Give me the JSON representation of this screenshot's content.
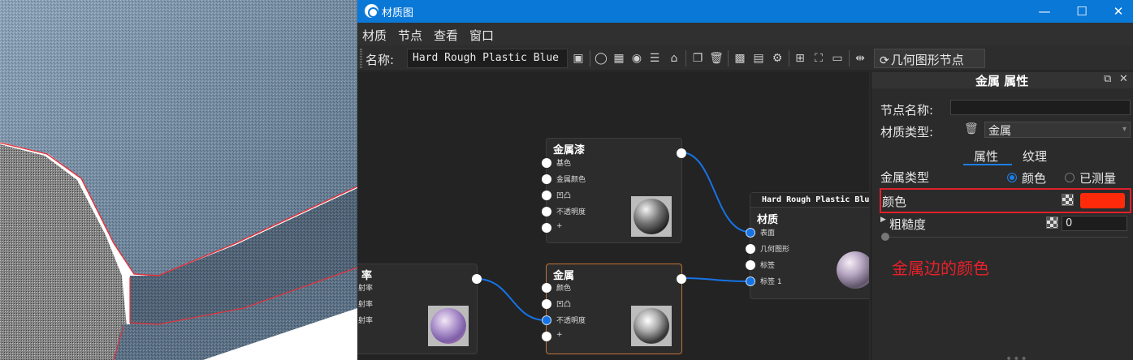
{
  "window": {
    "title": "材质图",
    "minimize_glyph": "—",
    "maximize_glyph": "☐",
    "close_glyph": "✕"
  },
  "menu": [
    "材质",
    "节点",
    "查看",
    "窗口"
  ],
  "toolbar": {
    "name_label": "名称:",
    "name_value": "Hard Rough Plastic Blue",
    "icons": [
      "save-icon",
      "sphere-preview-icon",
      "checker-icon",
      "play-icon",
      "sliders-icon",
      "layout-icon",
      "duplicate-icon",
      "delete-icon",
      "add-node-icon",
      "grid-icon",
      "settings-icon",
      "align-icon",
      "fit-icon",
      "zoom-100-icon",
      "arrange-icon"
    ],
    "geometry_button": "几何图形节点"
  },
  "nodes": {
    "metal_paint": {
      "title": "金属漆",
      "ports": [
        "基色",
        "金属颜色",
        "凹凸",
        "不透明度",
        "+"
      ]
    },
    "metal": {
      "title": "金属",
      "ports": [
        "颜色",
        "凹凸",
        "不透明度",
        "+"
      ]
    },
    "left_partial": {
      "title": "率",
      "ports": [
        "射率",
        "射率",
        "射率"
      ]
    },
    "material": {
      "header": "Hard Rough Plastic Blue",
      "title": "材质",
      "ports": [
        "表面",
        "几何图形",
        "标签",
        "标签 1"
      ]
    }
  },
  "properties": {
    "panel_title": "金属 属性",
    "node_name_label": "节点名称:",
    "node_name_value": "",
    "material_type_label": "材质类型:",
    "material_type_value": "金属",
    "tabs": [
      "属性",
      "纹理"
    ],
    "active_tab": "属性",
    "metal_type_label": "金属类型",
    "metal_type_options": [
      "颜色",
      "已测量"
    ],
    "metal_type_selected": "颜色",
    "color_label": "颜色",
    "color_value": "#ff2a0a",
    "roughness_label": "粗糙度",
    "roughness_value": "0",
    "annotation": "金属边的颜色"
  },
  "colors": {
    "titlebar": "#0a78d7",
    "accent": "#1c7ee6",
    "selected_node_border": "#c0743a",
    "highlight": "#e0202a",
    "wire": "#1673e6"
  }
}
